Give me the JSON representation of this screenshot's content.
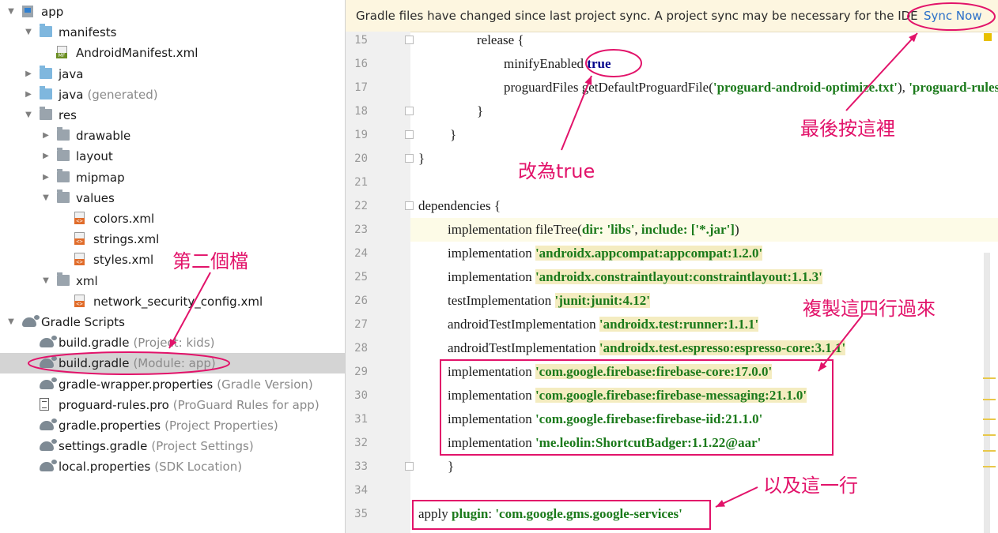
{
  "tree": {
    "rows": [
      {
        "label": "app",
        "hint": ""
      },
      {
        "label": "manifests",
        "hint": ""
      },
      {
        "label": "AndroidManifest.xml",
        "hint": ""
      },
      {
        "label": "java",
        "hint": ""
      },
      {
        "label": "java",
        "hint": "(generated)"
      },
      {
        "label": "res",
        "hint": ""
      },
      {
        "label": "drawable",
        "hint": ""
      },
      {
        "label": "layout",
        "hint": ""
      },
      {
        "label": "mipmap",
        "hint": ""
      },
      {
        "label": "values",
        "hint": ""
      },
      {
        "label": "colors.xml",
        "hint": ""
      },
      {
        "label": "strings.xml",
        "hint": ""
      },
      {
        "label": "styles.xml",
        "hint": ""
      },
      {
        "label": "xml",
        "hint": ""
      },
      {
        "label": "network_security_config.xml",
        "hint": ""
      },
      {
        "label": "Gradle Scripts",
        "hint": ""
      },
      {
        "label": "build.gradle",
        "hint": "(Project: kids)"
      },
      {
        "label": "build.gradle",
        "hint": "(Module: app)"
      },
      {
        "label": "gradle-wrapper.properties",
        "hint": "(Gradle Version)"
      },
      {
        "label": "proguard-rules.pro",
        "hint": "(ProGuard Rules for app)"
      },
      {
        "label": "gradle.properties",
        "hint": "(Project Properties)"
      },
      {
        "label": "settings.gradle",
        "hint": "(Project Settings)"
      },
      {
        "label": "local.properties",
        "hint": "(SDK Location)"
      }
    ]
  },
  "banner": {
    "message": "Gradle files have changed since last project sync. A project sync may be necessary for the IDE to work properly.",
    "action": "Sync Now"
  },
  "code": {
    "lines": [
      {
        "n": "15",
        "parts": [
          {
            "t": "release {",
            "c": ""
          }
        ]
      },
      {
        "n": "16",
        "parts": [
          {
            "t": "minifyEnabled ",
            "c": ""
          },
          {
            "t": "true",
            "c": "kw"
          }
        ]
      },
      {
        "n": "17",
        "parts": [
          {
            "t": "proguardFiles ",
            "c": ""
          },
          {
            "t": "getDefaultProguardFile(",
            "c": ""
          },
          {
            "t": "'proguard-android-optimize.txt'",
            "c": "str"
          },
          {
            "t": "), ",
            "c": ""
          },
          {
            "t": "'proguard-rules.pro'",
            "c": "str"
          }
        ]
      },
      {
        "n": "18",
        "parts": [
          {
            "t": "}",
            "c": ""
          }
        ]
      },
      {
        "n": "19",
        "parts": [
          {
            "t": "}",
            "c": ""
          }
        ]
      },
      {
        "n": "20",
        "parts": [
          {
            "t": "}",
            "c": ""
          }
        ]
      },
      {
        "n": "21",
        "parts": []
      },
      {
        "n": "22",
        "parts": [
          {
            "t": "dependencies {",
            "c": ""
          }
        ]
      },
      {
        "n": "23",
        "parts": [
          {
            "t": "implementation ",
            "c": ""
          },
          {
            "t": "fileTree(",
            "c": ""
          },
          {
            "t": "dir: ",
            "c": "kwn"
          },
          {
            "t": "'libs'",
            "c": "str"
          },
          {
            "t": ", ",
            "c": ""
          },
          {
            "t": "include: ",
            "c": "kwn"
          },
          {
            "t": "['*.jar']",
            "c": "str"
          },
          {
            "t": ")",
            "c": ""
          }
        ]
      },
      {
        "n": "24",
        "parts": [
          {
            "t": "implementation ",
            "c": ""
          },
          {
            "t": "'androidx.appcompat:appcompat:1.2.0'",
            "c": "strbg"
          }
        ]
      },
      {
        "n": "25",
        "parts": [
          {
            "t": "implementation ",
            "c": ""
          },
          {
            "t": "'androidx.constraintlayout:constraintlayout:1.1.3'",
            "c": "strbg"
          }
        ]
      },
      {
        "n": "26",
        "parts": [
          {
            "t": "testImplementation ",
            "c": ""
          },
          {
            "t": "'junit:junit:4.12'",
            "c": "strbg"
          }
        ]
      },
      {
        "n": "27",
        "parts": [
          {
            "t": "androidTestImplementation ",
            "c": ""
          },
          {
            "t": "'androidx.test:runner:1.1.1'",
            "c": "strbg"
          }
        ]
      },
      {
        "n": "28",
        "parts": [
          {
            "t": "androidTestImplementation ",
            "c": ""
          },
          {
            "t": "'androidx.test.espresso:espresso-core:3.1.1'",
            "c": "strbg"
          }
        ]
      },
      {
        "n": "29",
        "parts": [
          {
            "t": "implementation ",
            "c": ""
          },
          {
            "t": "'com.google.firebase:firebase-core:17.0.0'",
            "c": "strbg"
          }
        ]
      },
      {
        "n": "30",
        "parts": [
          {
            "t": "implementation ",
            "c": ""
          },
          {
            "t": "'com.google.firebase:firebase-messaging:21.1.0'",
            "c": "strbg"
          }
        ]
      },
      {
        "n": "31",
        "parts": [
          {
            "t": "implementation ",
            "c": ""
          },
          {
            "t": "'com.google.firebase:firebase-iid:21.1.0'",
            "c": "str"
          }
        ]
      },
      {
        "n": "32",
        "parts": [
          {
            "t": "implementation ",
            "c": ""
          },
          {
            "t": "'me.leolin:ShortcutBadger:1.1.22@aar'",
            "c": "str"
          }
        ]
      },
      {
        "n": "33",
        "parts": [
          {
            "t": "}",
            "c": ""
          }
        ]
      },
      {
        "n": "34",
        "parts": []
      },
      {
        "n": "35",
        "parts": [
          {
            "t": "apply ",
            "c": ""
          },
          {
            "t": "plugin",
            "c": "kwn"
          },
          {
            "t": ": ",
            "c": ""
          },
          {
            "t": "'com.google.gms.google-services'",
            "c": "str"
          }
        ]
      }
    ]
  },
  "annotations": {
    "change_to_true": "改為true",
    "press_here_last": "最後按這裡",
    "second_file": "第二個檔",
    "copy_four_lines": "複製這四行過來",
    "and_this_line": "以及這一行"
  },
  "colors": {
    "annotation": "#e2136a",
    "banner_bg": "#fdf6e0",
    "link": "#2a6fc9"
  }
}
